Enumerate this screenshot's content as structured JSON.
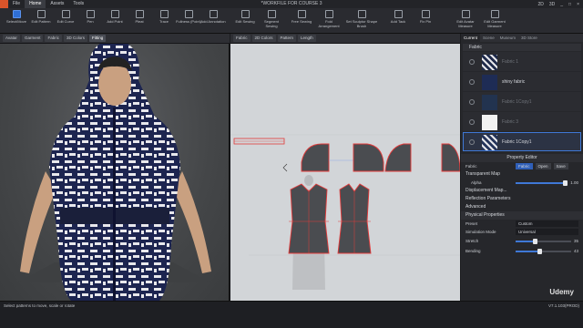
{
  "menu": {
    "items": [
      "File",
      "Home",
      "Assets",
      "Tools"
    ],
    "active": "Home"
  },
  "title": "*WORKFILE FOR COURSE 3",
  "window": {
    "mode_2d": "2D",
    "mode_3d": "3D",
    "controls": [
      "_",
      "□",
      "×"
    ]
  },
  "toolbar": {
    "tools": [
      {
        "label": "Select/Move",
        "selected": true
      },
      {
        "label": "Edit Pattern"
      },
      {
        "label": "Edit Curve"
      },
      {
        "label": "Pen"
      },
      {
        "label": "Add Point"
      },
      {
        "label": "Pleat"
      },
      {
        "label": "Trace"
      },
      {
        "label": "Fullness (Point)"
      },
      {
        "label": "Add Annotation"
      },
      {
        "label": "Edit Sewing"
      },
      {
        "label": "Segment Sewing"
      },
      {
        "label": "Free Sewing"
      },
      {
        "label": "Fold Arrangement"
      },
      {
        "label": "Set Sculptor Shape Brush"
      },
      {
        "label": "Add Tack"
      },
      {
        "label": "Fix Pin"
      },
      {
        "label": "Edit Avatar Measure"
      },
      {
        "label": "Edit Garment Measure"
      }
    ]
  },
  "view3d_tabs": [
    "Avatar",
    "Garment",
    "Fabric",
    "3D Colors",
    "Fitting"
  ],
  "view2d_tabs": [
    "Fabric",
    "2D Colors",
    "Pattern",
    "Length"
  ],
  "right_panel": {
    "tabs": [
      "Current",
      "Scene",
      "Museum",
      "3D Store"
    ],
    "active_tab": "Current",
    "object_header": "Fabric",
    "fabrics": [
      {
        "name": "Fabric 1",
        "dim": true,
        "swatch": "#1f2a4a",
        "selected": false
      },
      {
        "name": "shiny fabric",
        "dim": false,
        "swatch": "#1e2c55",
        "selected": false
      },
      {
        "name": "Fabric 1Copy1",
        "dim": true,
        "swatch": "#22334f",
        "selected": false
      },
      {
        "name": "Fabric 3",
        "dim": true,
        "swatch": "#f2f2f2",
        "selected": false
      },
      {
        "name": "Fabric 1Copy1",
        "dim": false,
        "swatch": "#25345a",
        "selected": true
      }
    ]
  },
  "property_editor": {
    "title": "Property Editor",
    "object_label": "Fabric",
    "fabric_btn": "Fabric",
    "open_btn": "Open",
    "save_btn": "Save",
    "sections": {
      "transparent_map": "Transparent Map",
      "alpha_label": "Alpha",
      "alpha_value": "1.00",
      "displacement_map": "Displacement Map...",
      "reflection": "Reflection Parameters",
      "advanced": "Advanced",
      "physical": "Physical Properties"
    },
    "preset_label": "Preset",
    "preset_value": "Custom",
    "sim_label": "Simulation Mode",
    "sim_value": "Universal",
    "stretch_label": "Stretch",
    "stretch_values": [
      "35",
      "35"
    ],
    "bending_label": "Bending",
    "bending_values": [
      "43",
      "43"
    ]
  },
  "status": {
    "left": "Select patterns to move, scale or rotate",
    "right": "V7.1.103(PROD)"
  },
  "watermark": "Udemy",
  "colors": {
    "accent": "#3f78d6",
    "pattern_outline": "#e23a3a",
    "pattern_fill": "#4a4c50"
  }
}
